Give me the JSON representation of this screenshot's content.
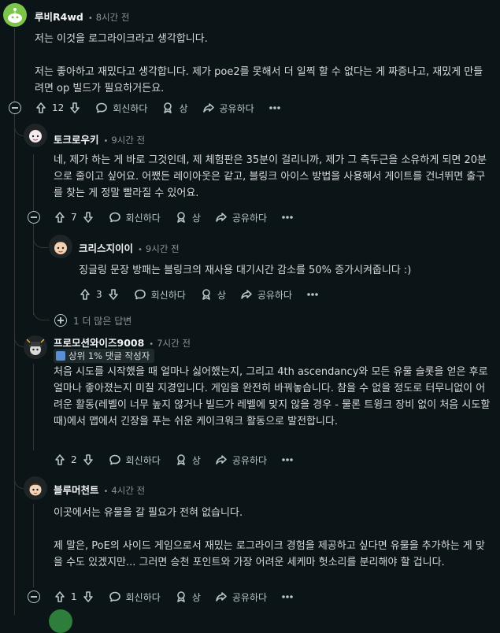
{
  "comments": [
    {
      "username": "루비R4wd",
      "time": "8시간 전",
      "body": "저는 이것을 로그라이크라고 생각합니다.\n\n저는 좋아하고 재밌다고 생각합니다. 제가 poe2를 못해서 더 일찍 할 수 없다는 게 짜증나고, 재밌게 만들려면 op 빌드가 필요하거든요.",
      "votes": "12",
      "reply_label": "회신하다",
      "award_label": "상",
      "share_label": "공유하다"
    },
    {
      "username": "토크로우키",
      "time": "9시간 전",
      "body": "네, 제가 하는 게 바로 그것인데, 제 체험판은 35분이 걸리니까, 제가 그 측두근을 소유하게 되면 20분으로 줄이고 싶어요. 어쨌든 레이아웃은 같고, 블링크 아이스 방법을 사용해서 게이트를 건너뛰면 출구를 찾는 게 정말 빨라질 수 있어요.",
      "votes": "7",
      "reply_label": "회신하다",
      "award_label": "상",
      "share_label": "공유하다"
    },
    {
      "username": "크리스지이이",
      "time": "9시간 전",
      "body": "징글링 문장 방패는 블링크의 재사용 대기시간 감소를 50% 증가시켜줍니다 :)",
      "votes": "3",
      "reply_label": "회신하다",
      "award_label": "상",
      "share_label": "공유하다"
    },
    {
      "username": "프로모션와이즈9008",
      "time": "7시간 전",
      "flair": "상위 1% 댓글 작성자",
      "body": "처음 시도를 시작했을 때 얼마나 싫어했는지, 그리고 4th ascendancy와 모든 유물 슬롯을 얻은 후로 얼마나 좋아졌는지 미칠 지경입니다. 게임을 완전히 바꿔놓습니다. 참을 수 없을 정도로 터무니없이 어려운 활동(레벨이 너무 높지 않거나 빌드가 레벨에 맞지 않을 경우 - 물론 트윙크 장비 없이 처음 시도할 때)에서 맵에서 긴장을 푸는 쉬운 케이크워크 활동으로 발전합니다.",
      "votes": "2",
      "reply_label": "회신하다",
      "award_label": "상",
      "share_label": "공유하다"
    },
    {
      "username": "블루머천트",
      "time": "4시간 전",
      "body": "이곳에서는 유물을 갈 필요가 전혀 없습니다.\n\n제 말은, PoE의 사이드 게임으로서 재밌는 로그라이크 경험을 제공하고 싶다면 유물을 추가하는 게 맞을 수도 있겠지만... 그러면 승천 포인트와 가장 어려운 세케마 헛소리를 분리해야 할 겁니다.",
      "votes": "1",
      "reply_label": "회신하다",
      "award_label": "상",
      "share_label": "공유하다"
    }
  ],
  "more_replies": "1 더 많은 답변",
  "icons": {
    "upvote": "arrow-up-icon",
    "downvote": "arrow-down-icon",
    "reply": "speech-bubble-icon",
    "award": "award-ribbon-icon",
    "share": "share-arrow-icon",
    "collapse": "minus-circle-icon",
    "expand": "plus-circle-icon"
  },
  "colors": {
    "background": "#0b1416",
    "text": "#d7dadc",
    "muted": "#8b9598",
    "thread_line": "#343536"
  }
}
